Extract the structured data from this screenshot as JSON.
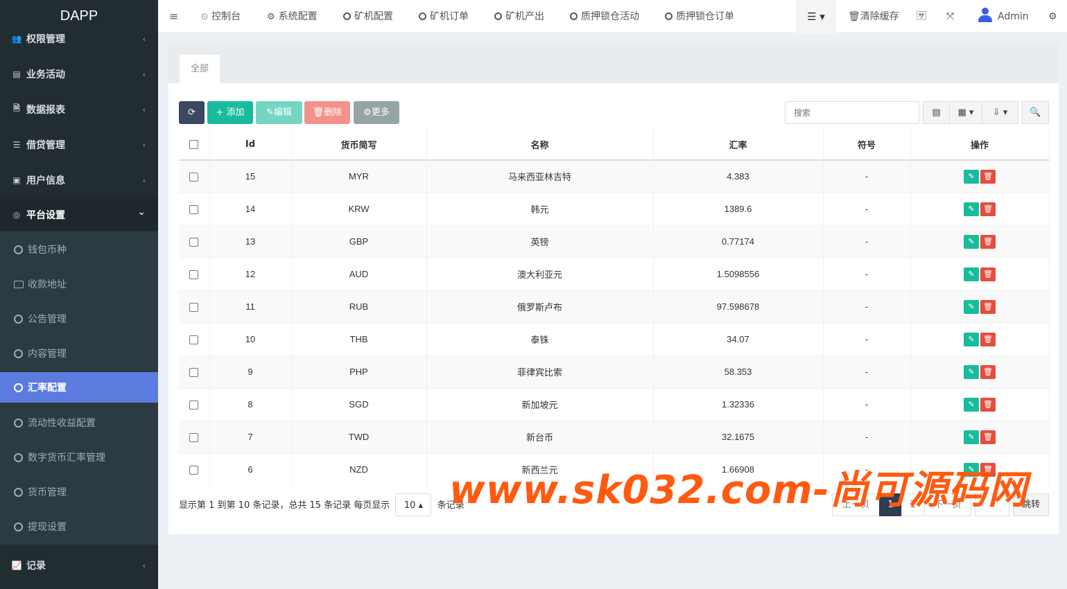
{
  "app": {
    "logo": "DAPP"
  },
  "sidebar": {
    "items": [
      {
        "label": "权限管理",
        "icon": "users-icon",
        "glyph": "👥"
      },
      {
        "label": "业务活动",
        "icon": "list-alt-icon",
        "glyph": "▤"
      },
      {
        "label": "数据报表",
        "icon": "file-text-icon",
        "glyph": "🗎"
      },
      {
        "label": "借贷管理",
        "icon": "list-icon",
        "glyph": "☰"
      },
      {
        "label": "用户信息",
        "icon": "address-book-icon",
        "glyph": "▣"
      },
      {
        "label": "平台设置",
        "icon": "dot-circle-icon",
        "glyph": "◎"
      }
    ],
    "sub_items": [
      {
        "label": "钱包币种"
      },
      {
        "label": "收款地址"
      },
      {
        "label": "公告管理"
      },
      {
        "label": "内容管理"
      },
      {
        "label": "汇率配置"
      },
      {
        "label": "流动性收益配置"
      },
      {
        "label": "数字货币汇率管理"
      },
      {
        "label": "货币管理"
      },
      {
        "label": "提现设置"
      }
    ],
    "bottom_item": {
      "label": "记录",
      "icon": "area-chart-icon",
      "glyph": "📈"
    },
    "arrow_glyph": "‹",
    "open_arrow_glyph": "⌄"
  },
  "topnav": {
    "menu_glyph": "≡",
    "tabs": [
      {
        "label": "控制台",
        "glyph": "⏲"
      },
      {
        "label": "系统配置",
        "glyph": "⚙"
      },
      {
        "label": "矿机配置"
      },
      {
        "label": "矿机订单"
      },
      {
        "label": "矿机产出"
      },
      {
        "label": "质押锁仓活动"
      },
      {
        "label": "质押锁仓订单"
      }
    ],
    "list_glyph": "☰ ▾",
    "clear_cache": "🗑清除缓存",
    "translate_glyph": "🈂",
    "fullscreen_glyph": "⤧",
    "user": "Admin",
    "settings_glyph": "⚙"
  },
  "tabs": {
    "all": "全部"
  },
  "toolbar": {
    "refresh": "⟳",
    "add": "+ 添加",
    "edit": "✎编辑",
    "delete": "🗑删除",
    "more": "⚙更多",
    "search_placeholder": "搜索",
    "view_glyph": "▤",
    "columns_glyph": "▦ ▾",
    "export_glyph": "⇩ ▾",
    "search_glyph": "🔍"
  },
  "table": {
    "headers": [
      "Id",
      "货币简写",
      "名称",
      "汇率",
      "符号",
      "操作"
    ],
    "rows": [
      {
        "id": "15",
        "code": "MYR",
        "name": "马来西亚林吉特",
        "rate": "4.383",
        "symbol": "-"
      },
      {
        "id": "14",
        "code": "KRW",
        "name": "韩元",
        "rate": "1389.6",
        "symbol": "-"
      },
      {
        "id": "13",
        "code": "GBP",
        "name": "英镑",
        "rate": "0.77174",
        "symbol": "-"
      },
      {
        "id": "12",
        "code": "AUD",
        "name": "澳大利亚元",
        "rate": "1.5098556",
        "symbol": "-"
      },
      {
        "id": "11",
        "code": "RUB",
        "name": "俄罗斯卢布",
        "rate": "97.598678",
        "symbol": "-"
      },
      {
        "id": "10",
        "code": "THB",
        "name": "泰铢",
        "rate": "34.07",
        "symbol": "-"
      },
      {
        "id": "9",
        "code": "PHP",
        "name": "菲律宾比索",
        "rate": "58.353",
        "symbol": "-"
      },
      {
        "id": "8",
        "code": "SGD",
        "name": "新加坡元",
        "rate": "1.32336",
        "symbol": "-"
      },
      {
        "id": "7",
        "code": "TWD",
        "name": "新台币",
        "rate": "32.1675",
        "symbol": "-"
      },
      {
        "id": "6",
        "code": "NZD",
        "name": "新西兰元",
        "rate": "1.66908",
        "symbol": "-"
      }
    ],
    "edit_glyph": "✎",
    "delete_glyph": "🗑"
  },
  "pagination": {
    "info_prefix": "显示第 1 到第 10 条记录，总共 15 条记录 每页显示",
    "page_size": "10 ▴",
    "info_suffix": "条记录",
    "prev": "上一页",
    "pages": [
      "1",
      "2"
    ],
    "next": "下一页",
    "jump": "跳转"
  },
  "watermark": "www.sk032.com-尚可源码网"
}
